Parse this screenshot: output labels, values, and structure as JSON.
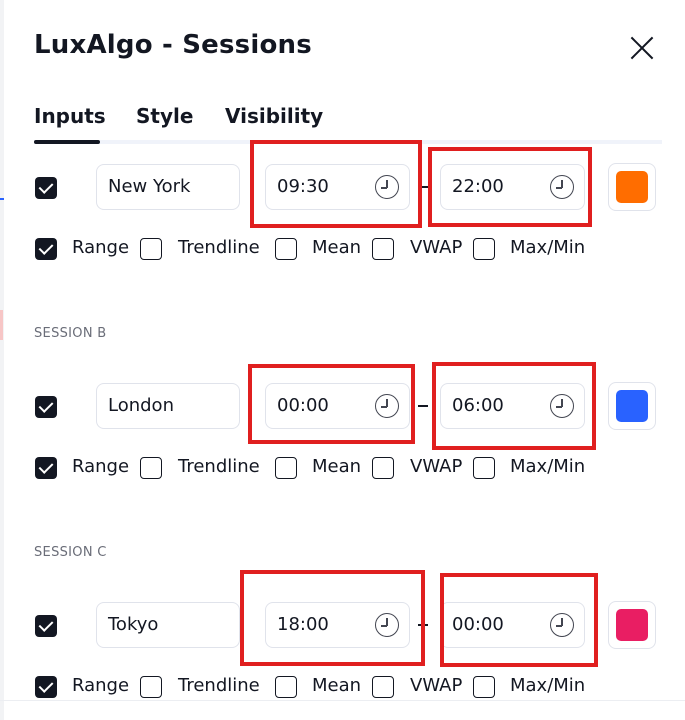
{
  "dialog": {
    "title": "LuxAlgo - Sessions"
  },
  "tabs": [
    {
      "label": "Inputs",
      "active": true
    },
    {
      "label": "Style",
      "active": false
    },
    {
      "label": "Visibility",
      "active": false
    }
  ],
  "options_labels": [
    "Range",
    "Trendline",
    "Mean",
    "VWAP",
    "Max/Min"
  ],
  "sessions": [
    {
      "header": "",
      "enabled": true,
      "name": "New York",
      "start": "09:30",
      "end": "22:00",
      "color": "#ff6d00",
      "options": {
        "range": true,
        "trendline": false,
        "mean": false,
        "vwap": false,
        "maxmin": false
      }
    },
    {
      "header": "SESSION B",
      "enabled": true,
      "name": "London",
      "start": "00:00",
      "end": "06:00",
      "color": "#2962ff",
      "options": {
        "range": true,
        "trendline": false,
        "mean": false,
        "vwap": false,
        "maxmin": false
      }
    },
    {
      "header": "SESSION C",
      "enabled": true,
      "name": "Tokyo",
      "start": "18:00",
      "end": "00:00",
      "color": "#e91e63",
      "options": {
        "range": true,
        "trendline": false,
        "mean": false,
        "vwap": false,
        "maxmin": false
      }
    }
  ],
  "annotation_color": "#e01f1f"
}
